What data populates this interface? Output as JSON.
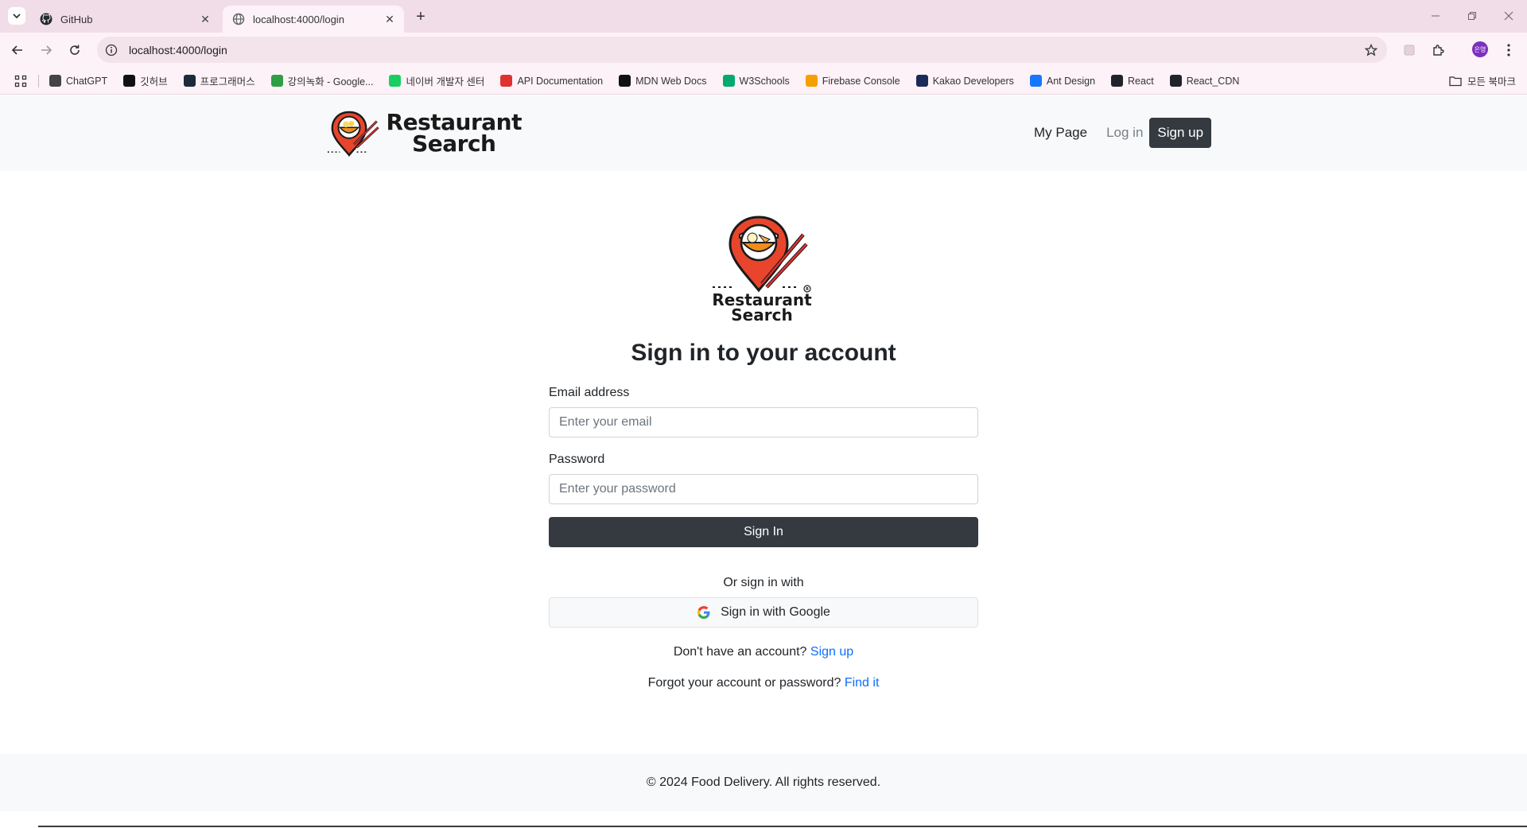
{
  "browser": {
    "tabs": [
      {
        "title": "GitHub",
        "icon": "github-icon",
        "active": false
      },
      {
        "title": "localhost:4000/login",
        "icon": "globe-icon",
        "active": true
      }
    ],
    "url": "localhost:4000/login",
    "profile_initials": "은영",
    "bookmarks": [
      {
        "label": "ChatGPT",
        "icon": "chatgpt-icon",
        "color": "#444444"
      },
      {
        "label": "깃허브",
        "icon": "github-icon",
        "color": "#111111"
      },
      {
        "label": "프로그래머스",
        "icon": "programmers-icon",
        "color": "#1e2a3a"
      },
      {
        "label": "강의녹화 - Google...",
        "icon": "google-drive-icon",
        "color": "#2f9e44"
      },
      {
        "label": "네이버 개발자 센터",
        "icon": "naver-icon",
        "color": "#19ce60"
      },
      {
        "label": "API Documentation",
        "icon": "api-docs-icon",
        "color": "#e03131"
      },
      {
        "label": "MDN Web Docs",
        "icon": "mdn-icon",
        "color": "#111111"
      },
      {
        "label": "W3Schools",
        "icon": "w3schools-icon",
        "color": "#04aa6d"
      },
      {
        "label": "Firebase Console",
        "icon": "firebase-icon",
        "color": "#f59f00"
      },
      {
        "label": "Kakao Developers",
        "icon": "kakao-icon",
        "color": "#1c2a59"
      },
      {
        "label": "Ant Design",
        "icon": "ant-design-icon",
        "color": "#1677ff"
      },
      {
        "label": "React",
        "icon": "react-icon",
        "color": "#20232a"
      },
      {
        "label": "React_CDN",
        "icon": "react-icon",
        "color": "#20232a"
      }
    ],
    "all_bookmarks_label": "모든 북마크"
  },
  "header": {
    "brand_line1": "Restaurant",
    "brand_line2": "Search",
    "nav": {
      "mypage": "My Page",
      "login": "Log in",
      "signup": "Sign up"
    }
  },
  "main": {
    "logo_line1": "Restaurant",
    "logo_line2": "Search",
    "title": "Sign in to your account",
    "email_label": "Email address",
    "email_placeholder": "Enter your email",
    "password_label": "Password",
    "password_placeholder": "Enter your password",
    "signin_button": "Sign In",
    "or_text": "Or sign in with",
    "google_button": "Sign in with Google",
    "no_account_text": "Don't have an account?",
    "signup_link": "Sign up",
    "forgot_text": "Forgot your account or password?",
    "find_link": "Find it"
  },
  "footer": {
    "text": "© 2024 Food Delivery. All rights reserved."
  },
  "colors": {
    "primary_dark": "#343a40",
    "link": "#0d6efd",
    "header_bg": "#f8f9fa",
    "logo_red": "#e8452c"
  }
}
